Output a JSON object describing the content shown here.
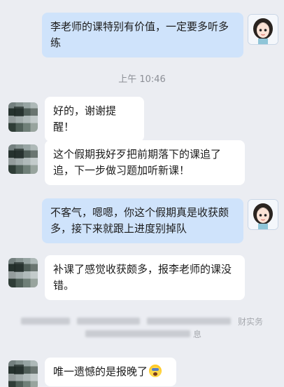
{
  "timestamp": "上午 10:46",
  "messages": [
    {
      "side": "out",
      "text": "李老师的课特别有价值，一定要多听多练"
    },
    {
      "side": "in",
      "text": "好的，谢谢提醒！"
    },
    {
      "side": "in",
      "text": "这个假期我好歹把前期落下的课追了追，下一步做习题加听新课！"
    },
    {
      "side": "out",
      "text": "不客气，嗯嗯，你这个假期真是收获颇多，接下来就跟上进度别掉队"
    },
    {
      "side": "in",
      "text": "补课了感觉收获颇多，报李老师的课没错。"
    },
    {
      "side": "in",
      "text": "唯一遗憾的是报晚了",
      "emoji": "scream-emoji"
    }
  ],
  "blurred_notice": {
    "tail_top": "财实务",
    "tail_bottom": "息"
  },
  "colors": {
    "background": "#ebedf2",
    "incoming_bubble": "#ffffff",
    "outgoing_bubble": "#cfe3fb"
  }
}
